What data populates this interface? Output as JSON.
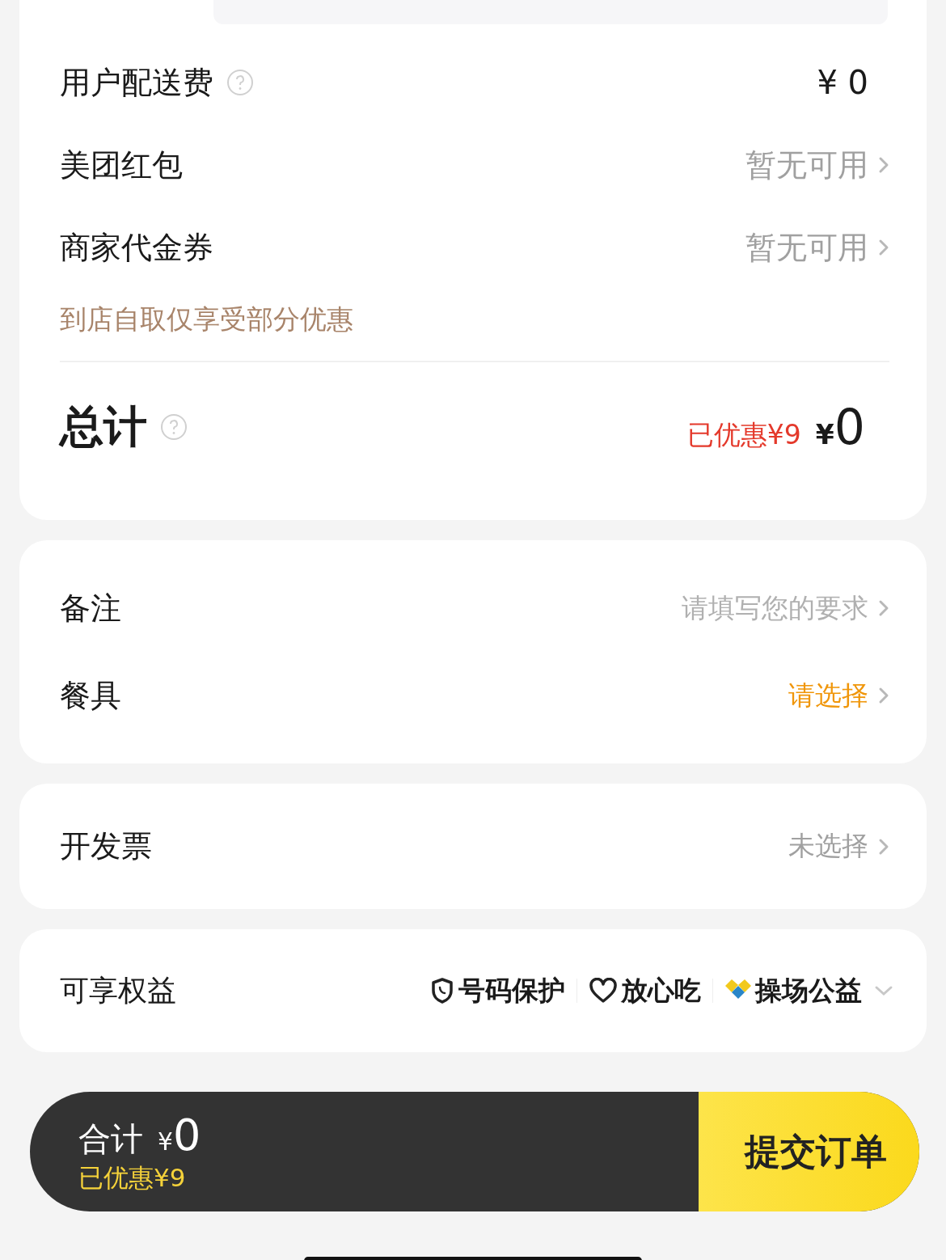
{
  "fee_card": {
    "rows": [
      {
        "kind": "fee",
        "label": "用户配送费",
        "currency": "¥",
        "amount": "0"
      },
      {
        "kind": "link",
        "label": "美团红包",
        "value": "暂无可用"
      },
      {
        "kind": "link",
        "label": "商家代金券",
        "value": "暂无可用"
      }
    ],
    "note": "到店自取仅享受部分优惠",
    "total": {
      "label": "总计",
      "discount": "已优惠¥9",
      "currency": "¥",
      "amount": "0"
    }
  },
  "options_card": {
    "rows": [
      {
        "kind": "hint",
        "label": "备注",
        "value": "请填写您的要求"
      },
      {
        "kind": "prompt",
        "label": "餐具",
        "value": "请选择"
      }
    ]
  },
  "invoice_card": {
    "label": "开发票",
    "value": "未选择"
  },
  "benefits": {
    "label": "可享权益",
    "items": [
      {
        "kind": "shield",
        "text": "号码保护"
      },
      {
        "kind": "heart",
        "text": "放心吃"
      },
      {
        "kind": "charity",
        "text": "操场公益"
      }
    ]
  },
  "bottom_bar": {
    "total_label": "合计",
    "currency": "¥",
    "amount": "0",
    "discount": "已优惠¥9",
    "submit": "提交订单"
  }
}
